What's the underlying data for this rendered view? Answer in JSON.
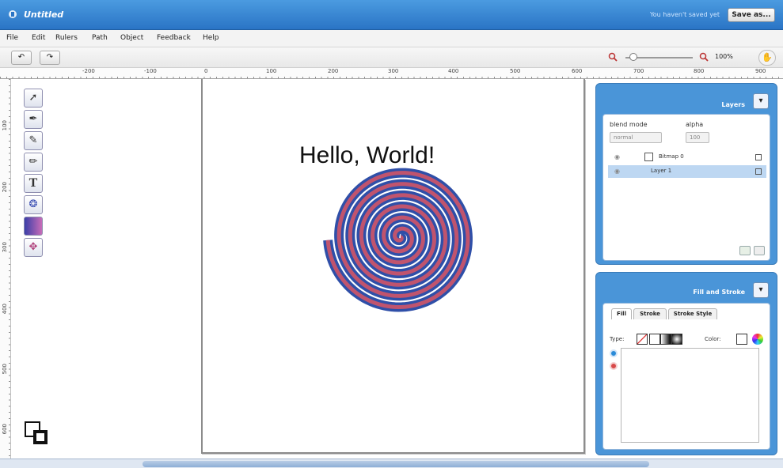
{
  "window": {
    "title": "Untitled",
    "save_status": "You haven't saved yet",
    "save_button": "Save as..."
  },
  "menu": [
    "File",
    "Edit",
    "Rulers",
    "Path",
    "Object",
    "Feedback",
    "Help"
  ],
  "toolbar": {
    "undo": "↶",
    "redo": "↷",
    "zoom_value": "100%",
    "hand": "✋"
  },
  "rulers": {
    "horizontal": [
      "-200",
      "-100",
      "0",
      "100",
      "200",
      "300",
      "400",
      "500",
      "600",
      "700",
      "800",
      "900"
    ],
    "vertical": [
      "100",
      "200",
      "300",
      "400",
      "500",
      "600"
    ]
  },
  "tools": [
    {
      "name": "select-tool",
      "glyph": "➚"
    },
    {
      "name": "pen-tool",
      "glyph": "✒"
    },
    {
      "name": "eyedropper-tool",
      "glyph": "✎"
    },
    {
      "name": "pencil-tool",
      "glyph": "✏"
    },
    {
      "name": "text-tool",
      "glyph": "T"
    },
    {
      "name": "spiral-tool",
      "glyph": "❂"
    },
    {
      "name": "gradient-tool",
      "glyph": "■"
    },
    {
      "name": "transform-tool",
      "glyph": "✥"
    }
  ],
  "canvas": {
    "text": "Hello, World!",
    "spiral_colors": {
      "outer": "#2f4fa8",
      "inner": "#c0546e"
    }
  },
  "layers_panel": {
    "title": "Layers",
    "blend_mode_label": "blend mode",
    "blend_mode_value": "normal",
    "alpha_label": "alpha",
    "alpha_value": "100",
    "layers": [
      {
        "name": "Bitmap 0",
        "selected": false
      },
      {
        "name": "Layer 1",
        "selected": true
      }
    ]
  },
  "fill_stroke_panel": {
    "title": "Fill and Stroke",
    "tabs": [
      "Fill",
      "Stroke",
      "Stroke Style"
    ],
    "type_label": "Type:",
    "color_label": "Color:"
  },
  "colors": {
    "titlebar": "#3486d4",
    "panel": "#4a95d8",
    "selected_layer": "#bdd7f2"
  }
}
